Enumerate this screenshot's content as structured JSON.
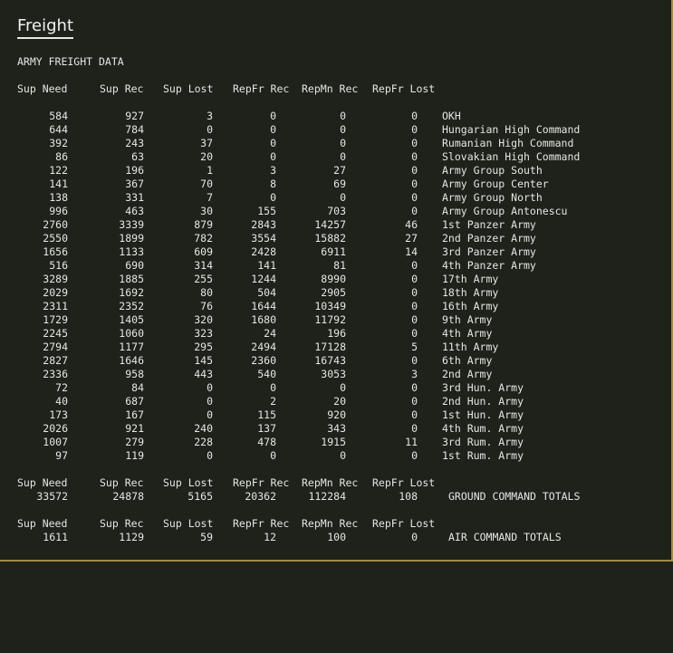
{
  "window": {
    "title": "Freight"
  },
  "section_title": "ARMY FREIGHT DATA",
  "columns": [
    "Sup Need",
    "Sup Rec",
    "Sup Lost",
    "RepFr Rec",
    "RepMn Rec",
    "RepFr Lost"
  ],
  "rows": [
    [
      "584",
      "927",
      "3",
      "0",
      "0",
      "0",
      "OKH"
    ],
    [
      "644",
      "784",
      "0",
      "0",
      "0",
      "0",
      "Hungarian High Command"
    ],
    [
      "392",
      "243",
      "37",
      "0",
      "0",
      "0",
      "Rumanian High Command"
    ],
    [
      "86",
      "63",
      "20",
      "0",
      "0",
      "0",
      "Slovakian High Command"
    ],
    [
      "122",
      "196",
      "1",
      "3",
      "27",
      "0",
      "Army Group South"
    ],
    [
      "141",
      "367",
      "70",
      "8",
      "69",
      "0",
      "Army Group Center"
    ],
    [
      "138",
      "331",
      "7",
      "0",
      "0",
      "0",
      "Army Group North"
    ],
    [
      "996",
      "463",
      "30",
      "155",
      "703",
      "0",
      "Army Group Antonescu"
    ],
    [
      "2760",
      "3339",
      "879",
      "2843",
      "14257",
      "46",
      "1st Panzer Army"
    ],
    [
      "2550",
      "1899",
      "782",
      "3554",
      "15882",
      "27",
      "2nd Panzer Army"
    ],
    [
      "1656",
      "1133",
      "609",
      "2428",
      "6911",
      "14",
      "3rd Panzer Army"
    ],
    [
      "516",
      "690",
      "314",
      "141",
      "81",
      "0",
      "4th Panzer Army"
    ],
    [
      "3289",
      "1885",
      "255",
      "1244",
      "8990",
      "0",
      "17th Army"
    ],
    [
      "2029",
      "1692",
      "80",
      "504",
      "2905",
      "0",
      "18th Army"
    ],
    [
      "2311",
      "2352",
      "76",
      "1644",
      "10349",
      "0",
      "16th Army"
    ],
    [
      "1729",
      "1405",
      "320",
      "1680",
      "11792",
      "0",
      "9th Army"
    ],
    [
      "2245",
      "1060",
      "323",
      "24",
      "196",
      "0",
      "4th Army"
    ],
    [
      "2794",
      "1177",
      "295",
      "2494",
      "17128",
      "5",
      "11th Army"
    ],
    [
      "2827",
      "1646",
      "145",
      "2360",
      "16743",
      "0",
      "6th Army"
    ],
    [
      "2336",
      "958",
      "443",
      "540",
      "3053",
      "3",
      "2nd Army"
    ],
    [
      "72",
      "84",
      "0",
      "0",
      "0",
      "0",
      "3rd Hun. Army"
    ],
    [
      "40",
      "687",
      "0",
      "2",
      "20",
      "0",
      "2nd Hun. Army"
    ],
    [
      "173",
      "167",
      "0",
      "115",
      "920",
      "0",
      "1st Hun. Army"
    ],
    [
      "2026",
      "921",
      "240",
      "137",
      "343",
      "0",
      "4th Rum. Army"
    ],
    [
      "1007",
      "279",
      "228",
      "478",
      "1915",
      "11",
      "3rd Rum. Army"
    ],
    [
      "97",
      "119",
      "0",
      "0",
      "0",
      "0",
      "1st Rum. Army"
    ]
  ],
  "ground_totals": {
    "values": [
      "33572",
      "24878",
      "5165",
      "20362",
      "112284",
      "108"
    ],
    "label": "GROUND COMMAND TOTALS"
  },
  "air_totals": {
    "values": [
      "1611",
      "1129",
      "59",
      "12",
      "100",
      "0"
    ],
    "label": "AIR COMMAND TOTALS"
  }
}
